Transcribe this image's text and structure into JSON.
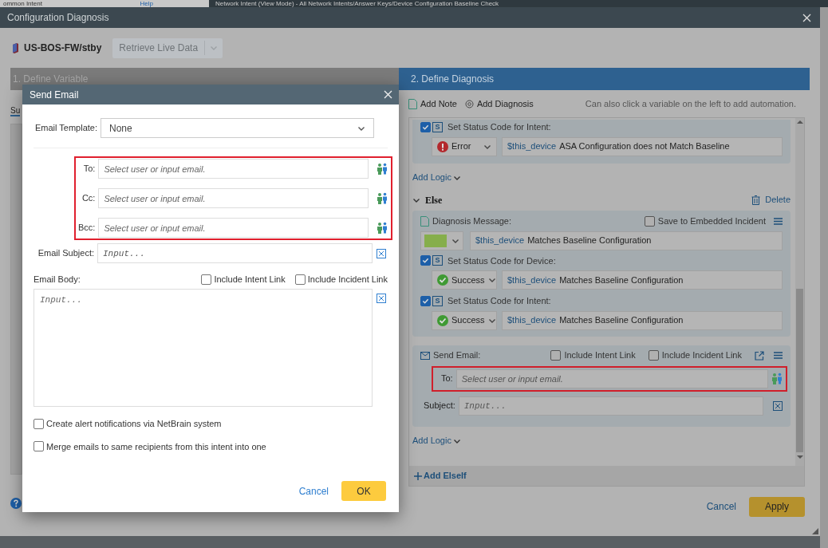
{
  "background": {
    "left_title": "ommon Intent",
    "help": "Help",
    "right_title": "Network Intent (View Mode) - All Network Intents/Answer Keys/Device Configuration Baseline Check"
  },
  "dialog": {
    "title": "Configuration Diagnosis",
    "device": "US-BOS-FW/stby",
    "retrieve": {
      "label": "Retrieve Live Data",
      "disabled": true
    },
    "steps": [
      {
        "label": "1. Define Variable",
        "selected": false
      },
      {
        "label": "2. Define Diagnosis",
        "selected": true
      }
    ],
    "left_tab": "Su",
    "toolbar": {
      "add_note": "Add Note",
      "add_diagnosis": "Add Diagnosis",
      "hint": "Can also click a variable on the left to add automation."
    },
    "if_status": {
      "label": "Set Status Code for Intent:",
      "tag": "S",
      "checked": true,
      "status": {
        "kind": "error",
        "label": "Error"
      },
      "variable": "$this_device",
      "message": "ASA Configuration does not Match Baseline"
    },
    "add_logic_1": "Add Logic",
    "else": {
      "title": "Else",
      "expanded": true,
      "delete": "Delete",
      "diagnosis": {
        "label": "Diagnosis Message:",
        "save_incident": {
          "label": "Save to Embedded Incident",
          "checked": false
        },
        "color": "#86ae4b",
        "variable": "$this_device",
        "message": "Matches Baseline Configuration"
      },
      "status_rows": [
        {
          "label": "Set Status Code for Device:",
          "tag": "S",
          "checked": true,
          "status": {
            "kind": "success",
            "label": "Success"
          },
          "variable": "$this_device",
          "message": "Matches Baseline Configuration"
        },
        {
          "label": "Set Status Code for Intent:",
          "tag": "S",
          "checked": true,
          "status": {
            "kind": "success",
            "label": "Success"
          },
          "variable": "$this_device",
          "message": "Matches Baseline Configuration"
        }
      ],
      "send_email": {
        "label": "Send Email:",
        "options": [
          {
            "label": "Include Intent Link",
            "checked": false
          },
          {
            "label": "Include Incident Link",
            "checked": false
          }
        ],
        "to": {
          "label": "To:",
          "placeholder": "Select user or input email."
        },
        "subject": {
          "label": "Subject:",
          "placeholder": "Input..."
        }
      }
    },
    "add_logic_2": "Add Logic",
    "add_elseif": "Add ElseIf",
    "cancel": "Cancel",
    "apply": "Apply"
  },
  "modal": {
    "title": "Send Email",
    "template": {
      "label": "Email Template:",
      "value": "None"
    },
    "recipients": [
      {
        "label": "To:",
        "placeholder": "Select user or input email."
      },
      {
        "label": "Cc:",
        "placeholder": "Select user or input email."
      },
      {
        "label": "Bcc:",
        "placeholder": "Select user or input email."
      }
    ],
    "subject": {
      "label": "Email Subject:",
      "placeholder": "Input..."
    },
    "body": {
      "label": "Email Body:",
      "placeholder": "Input..."
    },
    "body_options": [
      {
        "label": "Include Intent Link",
        "checked": false
      },
      {
        "label": "Include Incident Link",
        "checked": false
      }
    ],
    "options": [
      {
        "label": "Create alert notifications via NetBrain system",
        "checked": false
      },
      {
        "label": "Merge emails to same recipients from this intent into one",
        "checked": false
      }
    ],
    "cancel": "Cancel",
    "ok": "OK"
  }
}
